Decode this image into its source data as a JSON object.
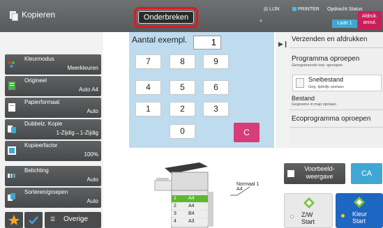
{
  "header": {
    "app_title": "Kopieren",
    "interrupt_button": "Onderbreken",
    "status_line": "LIJN",
    "status_printer": "PRINTER",
    "status_job": "Opdracht Status",
    "load_button": "Lade 1",
    "abort_button_line1": "Afdruk.",
    "abort_button_line2": "annul."
  },
  "settings": [
    {
      "label": "Kleurmodus",
      "value": "Meerkleuren",
      "icon": "color-mode-icon"
    },
    {
      "label": "Origineel",
      "value": "Auto A4",
      "icon": "original-icon"
    },
    {
      "label": "Papierformaat",
      "value": "Auto",
      "icon": "paper-size-icon"
    },
    {
      "label": "Dubbelz. Kopie",
      "value": "1-Zijdig→1-Zijdig",
      "icon": "duplex-icon"
    },
    {
      "label": "Kopieerfactor",
      "value": "100%",
      "icon": "zoom-icon"
    },
    {
      "label": "Belichting",
      "value": "Auto",
      "icon": "exposure-icon"
    },
    {
      "label": "Sorteren/groepen",
      "value": "Auto",
      "icon": "sort-icon"
    }
  ],
  "bottom_left": {
    "other_label": "Overige"
  },
  "keypad": {
    "title": "Aantal exempl.",
    "value": "1",
    "keys": [
      "7",
      "8",
      "9",
      "4",
      "5",
      "6",
      "1",
      "2",
      "3",
      "0"
    ],
    "clear": "C"
  },
  "right_panel": {
    "send_print": "Verzenden en afdrukken",
    "program_title": "Programma oproepen",
    "program_sub": "Geregistreerde inst. oproepen",
    "quick_title": "Snelbestand",
    "quick_sub": "Geg. tijdelijk opslaan",
    "file_title": "Bestand",
    "file_sub": "Gegevens in map opslaan",
    "eco": "Ecoprogramma oproepen"
  },
  "preview": {
    "preview_line1": "Voorbeeld-",
    "preview_line2": "weergave",
    "ca": "CA",
    "bw_line1": "Z/W",
    "bw_line2": "Start",
    "color_line1": "Kleur",
    "color_line2": "Start"
  },
  "machine": {
    "callout_line1": "Normaal 1",
    "callout_line2": "A4",
    "trays": [
      {
        "num": "1",
        "size": "A4"
      },
      {
        "num": "2",
        "size": "A4"
      },
      {
        "num": "3",
        "size": "B4"
      },
      {
        "num": "4",
        "size": "A3"
      }
    ]
  },
  "colors": {
    "accent_blue": "#3fa7d4",
    "highlight_red": "#e0181f",
    "clear_pink": "#d83c7b",
    "start_color": "#1d66c2"
  }
}
